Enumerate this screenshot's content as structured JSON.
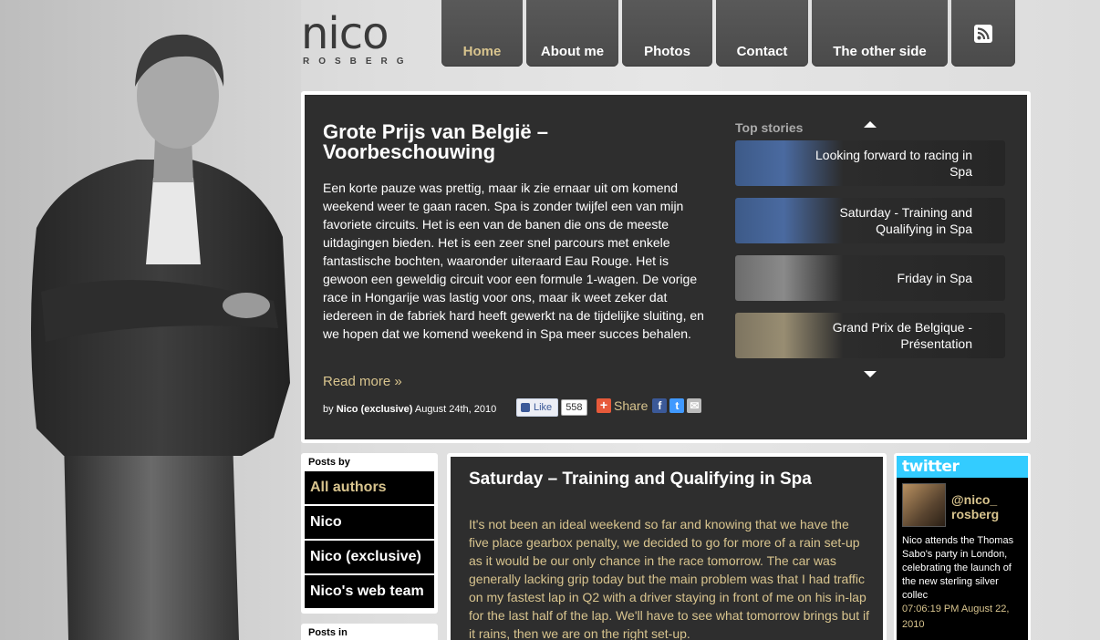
{
  "logo": {
    "wordmark": "nico",
    "sub": "ROSBERG"
  },
  "nav": {
    "items": [
      {
        "label": "Home"
      },
      {
        "label": "About me"
      },
      {
        "label": "Photos"
      },
      {
        "label": "Contact"
      },
      {
        "label": "The other side"
      }
    ],
    "rss_icon": "rss-icon"
  },
  "featured": {
    "title": "Grote Prijs van België – Voorbeschouwing",
    "body": "Een korte pauze was prettig, maar ik zie ernaar uit om komend weekend weer te gaan racen. Spa is zonder twijfel een van mijn favoriete circuits. Het is een van de banen die ons de meeste uitdagingen bieden. Het is een zeer snel parcours met enkele fantastische bochten, waaronder uiteraard Eau Rouge. Het is gewoon een geweldig circuit voor een formule 1-wagen. De vorige race in Hongarije was lastig voor ons, maar ik weet zeker dat iedereen in de fabriek hard heeft gewerkt na de tijdelijke sluiting, en we hopen dat we komend weekend in Spa meer succes behalen.",
    "read_more": "Read more »",
    "byline_prefix": "by",
    "author": "Nico (exclusive)",
    "date": "August 24th, 2010",
    "like_label": "Like",
    "like_count": "558",
    "share_label": "Share"
  },
  "top_stories": {
    "label": "Top stories",
    "items": [
      {
        "title": "Looking forward to racing in Spa"
      },
      {
        "title": "Saturday - Training and Qualifying in Spa"
      },
      {
        "title": "Friday in Spa"
      },
      {
        "title": "Grand Prix de Belgique - Présentation"
      }
    ]
  },
  "posts_by": {
    "heading": "Posts by",
    "items": [
      {
        "label": "All authors"
      },
      {
        "label": "Nico"
      },
      {
        "label": "Nico (exclusive)"
      },
      {
        "label": "Nico's web team"
      }
    ]
  },
  "posts_in": {
    "heading": "Posts in"
  },
  "article": {
    "title": "Saturday – Training and Qualifying in Spa",
    "body": "It's not been an ideal weekend so far and knowing that we have the five place gearbox penalty, we decided to go for more of a rain set-up as it would be our only chance in the race tomorrow. The car was generally lacking grip today but the main problem was that I had traffic on my fastest lap in Q2 with a driver staying in front of me on his in-lap for the last half of the lap. We'll have to see what tomorrow brings but if it rains, then we are on the right set-up."
  },
  "twitter": {
    "logo": "twitter",
    "handle_line1": "@nico_",
    "handle_line2": "rosberg",
    "tweet": "Nico attends the Thomas Sabo's party in London, celebrating the launch of the new sterling silver collec",
    "time": "07:06:19 PM August 22, 2010"
  },
  "colors": {
    "accent_gold": "#d8c48e",
    "panel_dark": "#2e2e2e",
    "twitter_blue": "#33ccff"
  }
}
